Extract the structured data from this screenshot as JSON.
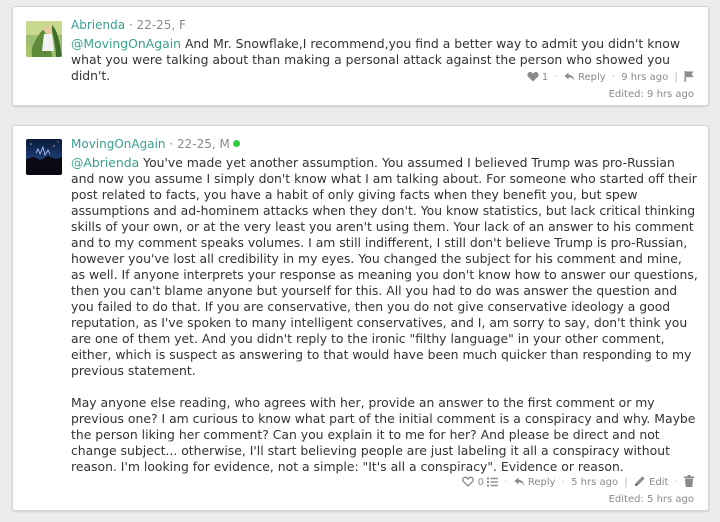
{
  "comments": [
    {
      "username": "Abrienda",
      "age_gender": " · 22-25, F",
      "mention": "@MovingOnAgain",
      "text": " And Mr. Snowflake,I recommend,you find a better way to admit you didn't know what you were talking about than making a personal attack against the person who showed you didn't.",
      "likes": "1",
      "reply_label": "Reply",
      "time": "9 hrs ago",
      "edited": "Edited: 9 hrs ago",
      "icons": [
        "heart-icon",
        "reply-icon",
        "flag-icon"
      ]
    },
    {
      "username": "MovingOnAgain",
      "age_gender": " · 22-25, M",
      "online_color": "#2ecc40",
      "mention": "@Abrienda",
      "text": " You've made yet another assumption. You assumed I believed Trump was pro-Russian and now you assume I simply don't know what I am talking about. For someone who started off their post related to facts, you have a habit of only giving facts when they benefit you, but spew assumptions and ad-hominem attacks when they don't. You know statistics, but lack critical thinking skills of your own, or at the very least you aren't using them. Your lack of an answer to his comment and to my comment speaks volumes. I am still indifferent, I still don't believe Trump is pro-Russian, however you've lost all credibility in my eyes. You changed the subject for his comment and mine, as well. If anyone interprets your response as meaning you don't know how to answer our questions, then you can't blame anyone but yourself for this. All you had to do was answer the question and you failed to do that. If you are conservative, then you do not give conservative ideology a good reputation, as I've spoken to many intelligent conservatives, and I, am sorry to say, don't think you are one of them yet. And you didn't reply to the ironic \"filthy language\" in your other comment, either, which is suspect as answering to that would have been much quicker than responding to my previous statement.",
      "text2": "May anyone else reading, who agrees with her, provide an answer to the first comment or my previous one? I am curious to know what part of the initial comment is a conspiracy and why. Maybe the person liking her comment? Can you explain it to me for her? And please be direct and not change subject... otherwise, I'll start believing people are just labeling it all a conspiracy without reason. I'm looking for evidence, not a simple: \"It's all a conspiracy\". Evidence or reason.",
      "likes": "0",
      "reply_label": "Reply",
      "time": "5 hrs ago",
      "edit_label": "Edit",
      "edited": "Edited: 5 hrs ago",
      "icons": [
        "heart-outline-icon",
        "list-icon",
        "reply-icon",
        "pencil-icon",
        "trash-icon"
      ]
    }
  ],
  "colors": {
    "username": "#3aa08f",
    "meta": "#8a8a8a",
    "background": "#ececec",
    "card": "#ffffff"
  }
}
